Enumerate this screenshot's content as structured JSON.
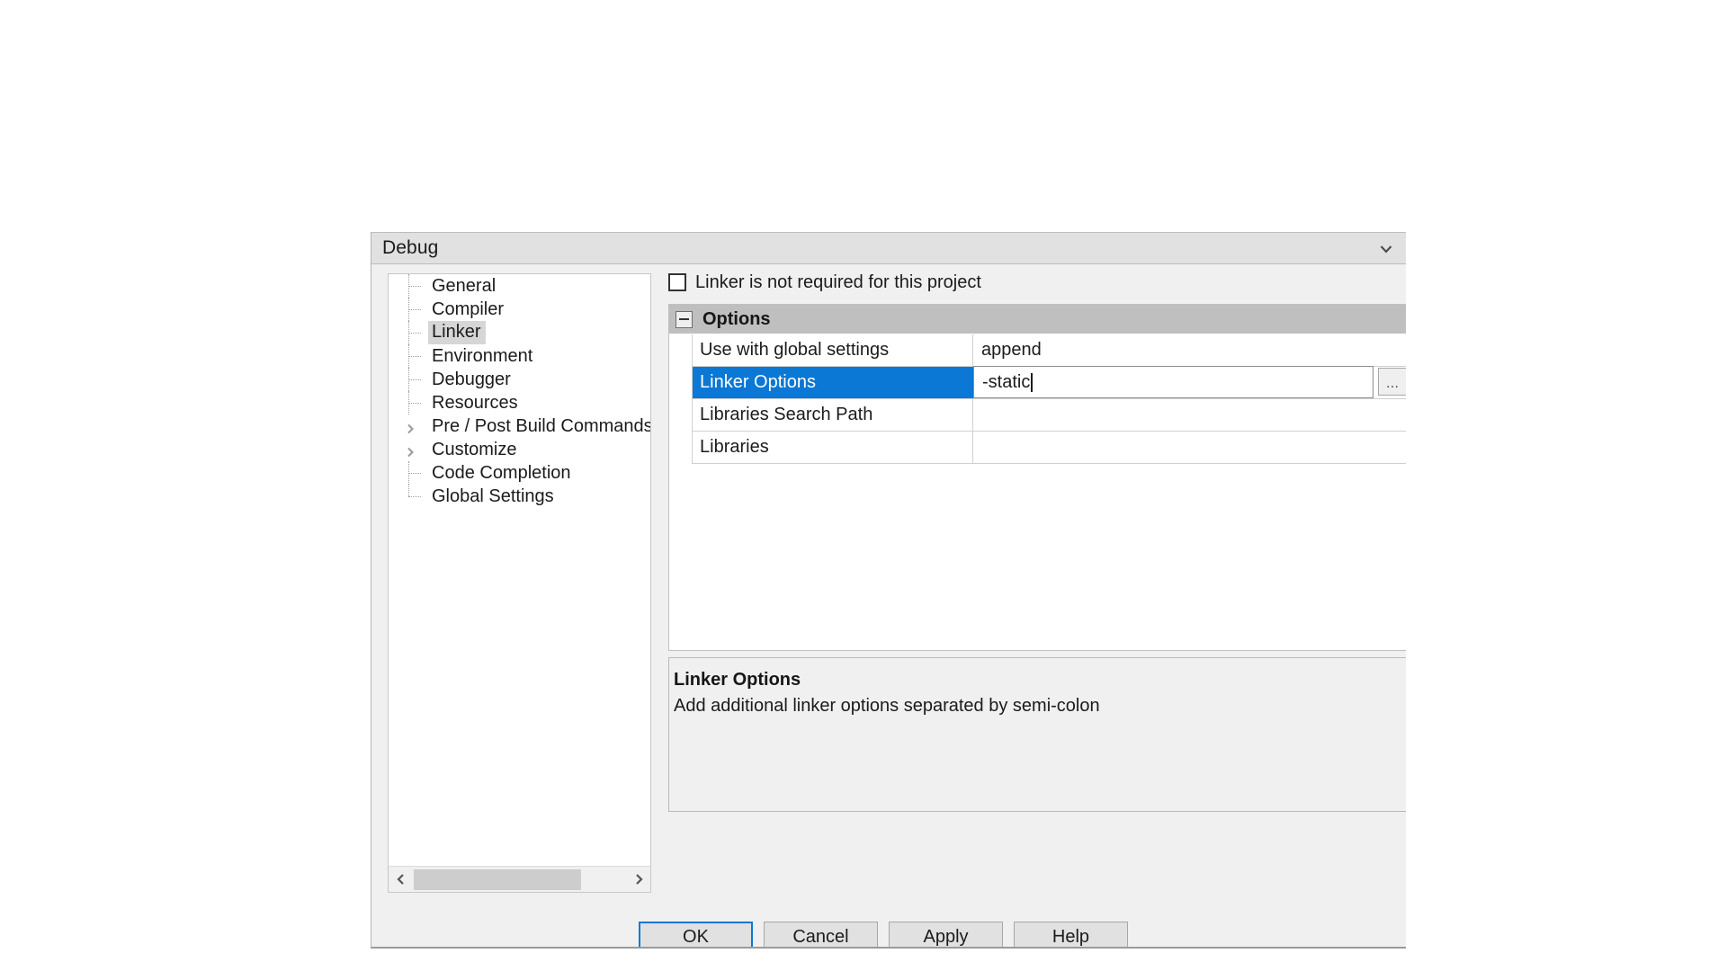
{
  "dialog": {
    "target_selector": {
      "value": "Debug",
      "icon": "chevron-down-icon"
    },
    "tree": {
      "items": [
        {
          "label": "General",
          "kind": "leaf",
          "selected": false
        },
        {
          "label": "Compiler",
          "kind": "leaf",
          "selected": false
        },
        {
          "label": "Linker",
          "kind": "leaf",
          "selected": true
        },
        {
          "label": "Environment",
          "kind": "leaf",
          "selected": false
        },
        {
          "label": "Debugger",
          "kind": "leaf",
          "selected": false
        },
        {
          "label": "Resources",
          "kind": "leaf",
          "selected": false
        },
        {
          "label": "Pre / Post Build Commands",
          "kind": "branch",
          "selected": false
        },
        {
          "label": "Customize",
          "kind": "branch",
          "selected": false
        },
        {
          "label": "Code Completion",
          "kind": "leaf",
          "selected": false
        },
        {
          "label": "Global Settings",
          "kind": "leaf",
          "selected": false
        }
      ],
      "scrollbar": {
        "left_arrow": "chevron-left-icon",
        "right_arrow": "chevron-right-icon"
      }
    },
    "not_required_checkbox": {
      "label": "Linker is not required for this project",
      "checked": false
    },
    "grid": {
      "group_title": "Options",
      "collapse_icon": "minus-box-icon",
      "rows": [
        {
          "name": "Use with global settings",
          "value": "append",
          "selected": false,
          "editing": false
        },
        {
          "name": "Linker Options",
          "value": "-static",
          "selected": true,
          "editing": true
        },
        {
          "name": "Libraries Search Path",
          "value": "",
          "selected": false,
          "editing": false
        },
        {
          "name": "Libraries",
          "value": "",
          "selected": false,
          "editing": false
        }
      ],
      "browse_button_label": "..."
    },
    "description": {
      "title": "Linker Options",
      "text": "Add additional linker options separated by semi-colon"
    },
    "buttons": {
      "ok": "OK",
      "cancel": "Cancel",
      "apply": "Apply",
      "help": "Help"
    },
    "colors": {
      "selection_blue": "#0a78d4",
      "group_header_gray": "#bfbfbf",
      "dialog_gray": "#f0f0f0",
      "tree_selected_gray": "#d6d6d6"
    }
  }
}
